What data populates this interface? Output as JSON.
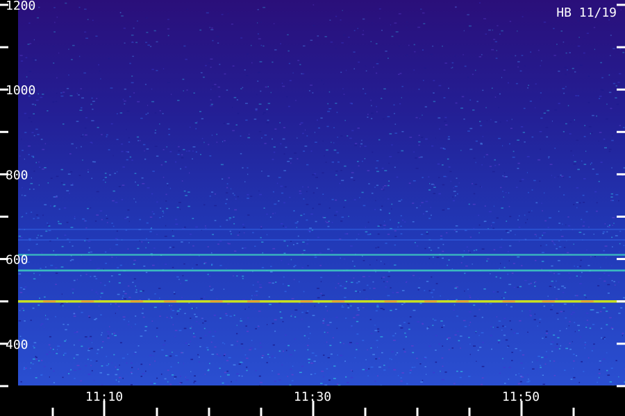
{
  "station_label": "HB 11/19",
  "colors": {
    "background": "#2a0f7a",
    "noise_low": "#1a1a8c",
    "noise_mid": "#2f5fe0",
    "band": "#3fd0c0",
    "band_strong": "#c8e020",
    "band_peak": "#e8a030",
    "axis": "#ffffff",
    "left_strip": "#000000",
    "bottom_strip": "#000000"
  },
  "chart_data": {
    "type": "heatmap",
    "title": "",
    "xlabel": "",
    "ylabel": "",
    "x_range": [
      "11:05",
      "11:55"
    ],
    "y_range": [
      290,
      1200
    ],
    "y_ticks": [
      400,
      600,
      800,
      1000,
      1200
    ],
    "y_tick_labels": [
      "400",
      "600",
      "800",
      "1000",
      "1200"
    ],
    "y_minor_ticks": [
      300,
      500,
      700,
      900,
      1100
    ],
    "x_ticks": [
      "11:10",
      "11:30",
      "11:50"
    ],
    "x_tick_labels": [
      "11:10",
      "11:30",
      "11:50"
    ],
    "bands": [
      {
        "y": 500,
        "intensity": 1.0
      },
      {
        "y": 573,
        "intensity": 0.7
      },
      {
        "y": 610,
        "intensity": 0.6
      },
      {
        "y": 645,
        "intensity": 0.35
      },
      {
        "y": 670,
        "intensity": 0.3
      }
    ]
  }
}
